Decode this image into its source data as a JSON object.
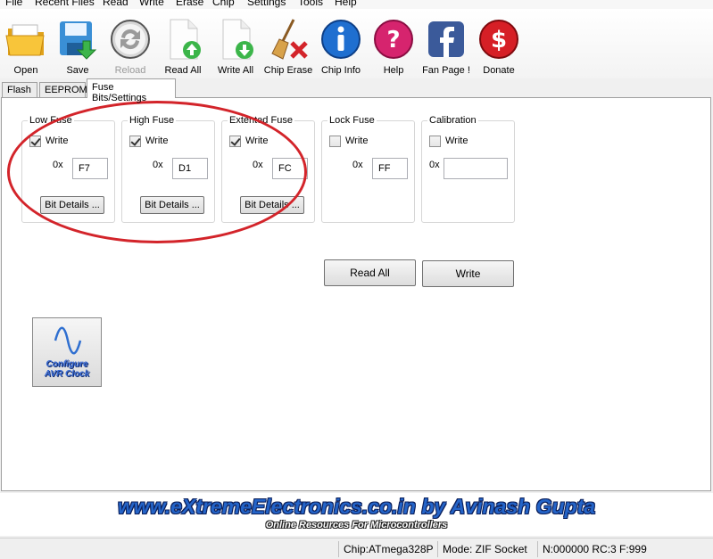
{
  "menu": [
    "File",
    "Recent Files",
    "Read",
    "Write",
    "Erase",
    "Chip",
    "Settings",
    "Tools",
    "Help"
  ],
  "toolbar": {
    "open": "Open",
    "save": "Save",
    "reload": "Reload",
    "read_all": "Read All",
    "write_all": "Write All",
    "chip_erase": "Chip Erase",
    "chip_info": "Chip Info",
    "help": "Help",
    "fan_page": "Fan Page !",
    "donate": "Donate"
  },
  "tabs": [
    "Flash",
    "EEPROM",
    "Fuse Bits/Settings"
  ],
  "active_tab": "Fuse Bits/Settings",
  "fuses": [
    {
      "title": "Low Fuse",
      "write_label": "Write",
      "write_checked": true,
      "prefix": "0x",
      "value": "F7",
      "details_label": "Bit Details ..."
    },
    {
      "title": "High Fuse",
      "write_label": "Write",
      "write_checked": true,
      "prefix": "0x",
      "value": "D1",
      "details_label": "Bit Details ..."
    },
    {
      "title": "Extented Fuse",
      "write_label": "Write",
      "write_checked": true,
      "prefix": "0x",
      "value": "FC",
      "details_label": "Bit Details ..."
    },
    {
      "title": "Lock Fuse",
      "write_label": "Write",
      "write_checked": false,
      "prefix": "0x",
      "value": "FF"
    },
    {
      "title": "Calibration",
      "write_label": "Write",
      "write_checked": false,
      "prefix": "0x",
      "value": ""
    }
  ],
  "actions": {
    "read_all": "Read All",
    "write": "Write"
  },
  "clock_button": {
    "line1": "Configure",
    "line2": "AVR Clock"
  },
  "banner": {
    "title": "www.eXtremeElectronics.co.in by Avinash Gupta",
    "subtitle": "Online Resources For Microcontrollers"
  },
  "status": {
    "chip": "Chip:ATmega328P",
    "mode": "Mode: ZIF Socket",
    "counters": "N:000000 RC:3 F:999"
  },
  "colors": {
    "highlight_ellipse": "#d3242a",
    "banner_text": "#2464c8"
  }
}
